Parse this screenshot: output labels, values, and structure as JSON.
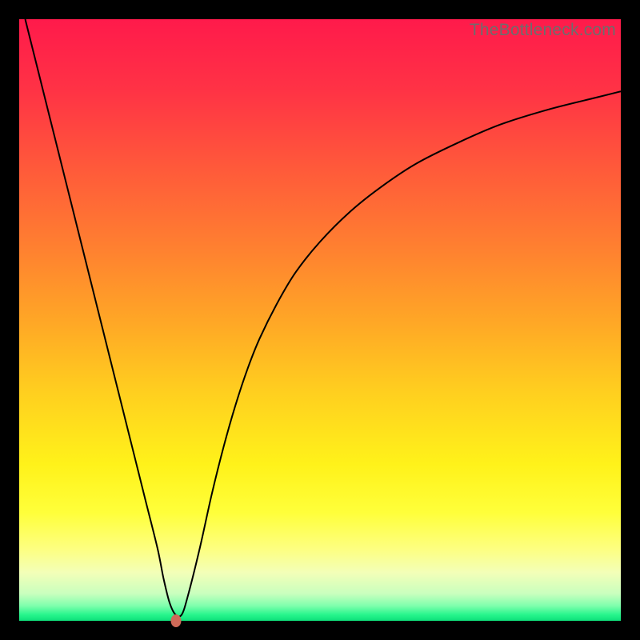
{
  "watermark": "TheBottleneck.com",
  "chart_data": {
    "type": "line",
    "title": "",
    "xlabel": "",
    "ylabel": "",
    "xlim": [
      0,
      100
    ],
    "ylim": [
      0,
      100
    ],
    "grid": false,
    "legend": false,
    "background": {
      "type": "vertical-gradient",
      "stops": [
        {
          "pos": 0.0,
          "color": "#ff1a4b"
        },
        {
          "pos": 0.12,
          "color": "#ff3345"
        },
        {
          "pos": 0.25,
          "color": "#ff5a3a"
        },
        {
          "pos": 0.38,
          "color": "#ff8030"
        },
        {
          "pos": 0.5,
          "color": "#ffa626"
        },
        {
          "pos": 0.62,
          "color": "#ffcf1f"
        },
        {
          "pos": 0.74,
          "color": "#fff21a"
        },
        {
          "pos": 0.82,
          "color": "#ffff3a"
        },
        {
          "pos": 0.88,
          "color": "#fdff80"
        },
        {
          "pos": 0.92,
          "color": "#f3ffb8"
        },
        {
          "pos": 0.955,
          "color": "#c9ffbe"
        },
        {
          "pos": 0.975,
          "color": "#7fffad"
        },
        {
          "pos": 0.99,
          "color": "#27f58c"
        },
        {
          "pos": 1.0,
          "color": "#0ee07a"
        }
      ]
    },
    "series": [
      {
        "name": "bottleneck-curve",
        "color": "#000000",
        "stroke_width": 2,
        "x": [
          1,
          3,
          5,
          7,
          9,
          11,
          13,
          15,
          17,
          19,
          21,
          23,
          24,
          25,
          26,
          27,
          28,
          30,
          32,
          34,
          36,
          38,
          40,
          43,
          46,
          50,
          55,
          60,
          66,
          73,
          80,
          88,
          96,
          100
        ],
        "y": [
          100,
          92,
          84,
          76,
          68,
          60,
          52,
          44,
          36,
          28,
          20,
          12,
          7,
          3,
          1,
          1,
          4,
          12,
          21,
          29,
          36,
          42,
          47,
          53,
          58,
          63,
          68,
          72,
          76,
          79.5,
          82.5,
          85,
          87,
          88
        ]
      }
    ],
    "marker": {
      "name": "optimal-point",
      "x": 26,
      "y": 0,
      "color": "#cf6a58"
    }
  }
}
